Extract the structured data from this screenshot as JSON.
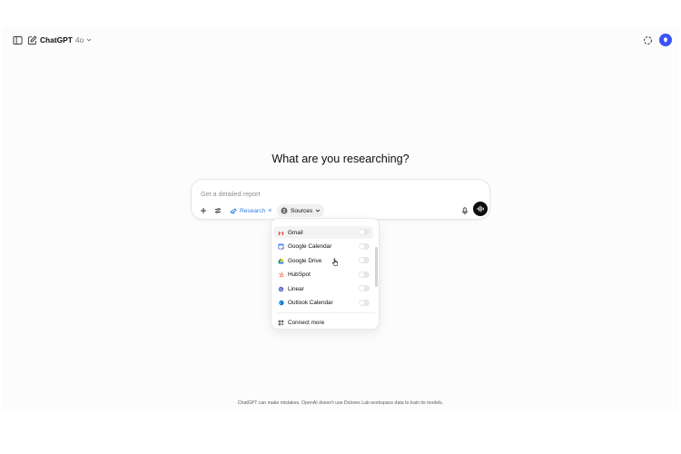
{
  "header": {
    "model_name": "ChatGPT",
    "model_version": "4o"
  },
  "hero": {
    "title": "What are you researching?"
  },
  "composer": {
    "placeholder": "Get a detailed report",
    "research_label": "Research",
    "research_close": "×",
    "sources_label": "Sources"
  },
  "sources_menu": {
    "items": [
      {
        "label": "Gmail",
        "icon": "gmail-icon",
        "enabled": false
      },
      {
        "label": "Google Calendar",
        "icon": "google-calendar-icon",
        "enabled": false
      },
      {
        "label": "Google Drive",
        "icon": "google-drive-icon",
        "enabled": false
      },
      {
        "label": "HubSpot",
        "icon": "hubspot-icon",
        "enabled": false
      },
      {
        "label": "Linear",
        "icon": "linear-icon",
        "enabled": false
      },
      {
        "label": "Outlook Calendar",
        "icon": "outlook-calendar-icon",
        "enabled": false
      }
    ],
    "connect_more": "Connect more"
  },
  "footer": {
    "disclaimer": "ChatGPT can make mistakes. OpenAI doesn't use Dolores Lab workspace data to train its models."
  },
  "colors": {
    "accent_blue": "#2f7de1",
    "avatar": "#3b53f0",
    "voice_button": "#0d0d0d"
  }
}
